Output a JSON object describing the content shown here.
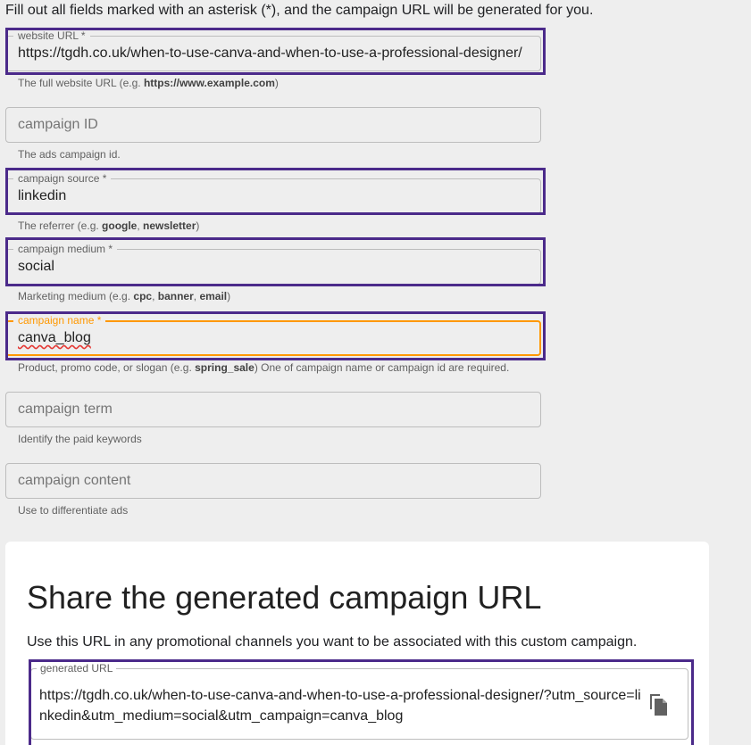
{
  "intro": "Fill out all fields marked with an asterisk (*), and the campaign URL will be generated for you.",
  "fields": {
    "website_url": {
      "label": "website URL *",
      "value": "https://tgdh.co.uk/when-to-use-canva-and-when-to-use-a-professional-designer/",
      "helper_pre": "The full website URL (e.g. ",
      "helper_bold": "https://www.example.com",
      "helper_post": ")"
    },
    "campaign_id": {
      "placeholder": "campaign ID",
      "helper": "The ads campaign id."
    },
    "campaign_source": {
      "label": "campaign source *",
      "value": "linkedin",
      "helper_pre": "The referrer (e.g. ",
      "helper_bold1": "google",
      "helper_sep": ", ",
      "helper_bold2": "newsletter",
      "helper_post": ")"
    },
    "campaign_medium": {
      "label": "campaign medium *",
      "value": "social",
      "helper_pre": "Marketing medium (e.g. ",
      "helper_bold1": "cpc",
      "helper_sep1": ", ",
      "helper_bold2": "banner",
      "helper_sep2": ", ",
      "helper_bold3": "email",
      "helper_post": ")"
    },
    "campaign_name": {
      "label": "campaign name *",
      "value": "canva_blog",
      "helper_pre": "Product, promo code, or slogan (e.g. ",
      "helper_bold": "spring_sale",
      "helper_post": ") One of campaign name or campaign id are required."
    },
    "campaign_term": {
      "placeholder": "campaign term",
      "helper": "Identify the paid keywords"
    },
    "campaign_content": {
      "placeholder": "campaign content",
      "helper": "Use to differentiate ads"
    }
  },
  "share": {
    "title": "Share the generated campaign URL",
    "description": "Use this URL in any promotional channels you want to be associated with this custom campaign.",
    "generated_label": "generated URL",
    "generated_value": "https://tgdh.co.uk/when-to-use-canva-and-when-to-use-a-professional-designer/?utm_source=linkedin&utm_medium=social&utm_campaign=canva_blog",
    "copy_icon": "copy-icon"
  },
  "colors": {
    "highlight": "#4b2a8a",
    "focus": "#ff9800",
    "background": "#eeeeee"
  }
}
